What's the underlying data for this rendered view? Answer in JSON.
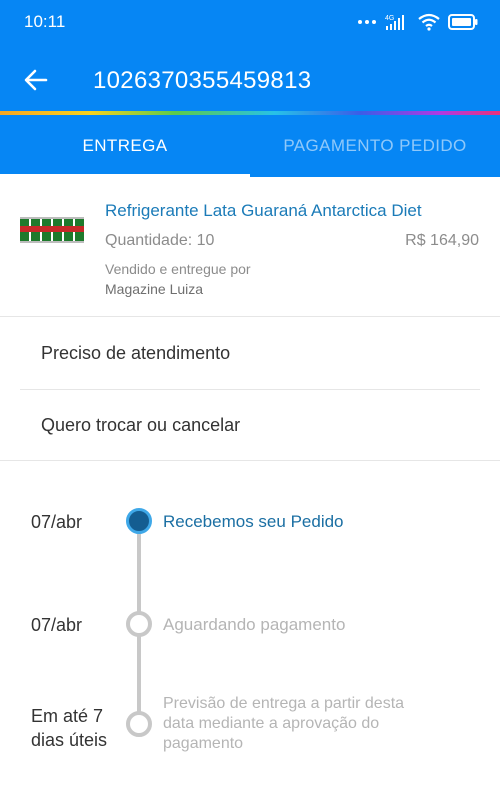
{
  "status_bar": {
    "time": "10:11",
    "network_label": "4G"
  },
  "app_bar": {
    "title": "1026370355459813"
  },
  "tabs": [
    {
      "label": "ENTREGA",
      "active": true
    },
    {
      "label": "PAGAMENTO PEDIDO",
      "active": false
    }
  ],
  "product": {
    "name": "Refrigerante Lata Guaraná Antarctica Diet",
    "quantity": "Quantidade: 10",
    "price": "R$ 164,90",
    "seller_line1": "Vendido e entregue por",
    "seller_line2": "Magazine Luiza"
  },
  "menu": {
    "items": [
      {
        "label": "Preciso de atendimento"
      },
      {
        "label": "Quero trocar ou cancelar"
      }
    ]
  },
  "timeline": {
    "steps": [
      {
        "date": "07/abr",
        "text": "Recebemos seu Pedido",
        "status": "done"
      },
      {
        "date": "07/abr",
        "text": "Aguardando pagamento",
        "status": "pending"
      },
      {
        "date_line1": "Em até 7",
        "date_line2": "dias úteis",
        "text_line1": "Previsão de entrega a partir desta",
        "text_line2": "data mediante a aprovação do",
        "text_line3": "pagamento",
        "status": "pending"
      }
    ]
  },
  "colors": {
    "header_blue": "#0686f4",
    "link_blue": "#1b7bb8",
    "timeline_active": "#145d91",
    "timeline_inactive": "#c8c8c8"
  }
}
